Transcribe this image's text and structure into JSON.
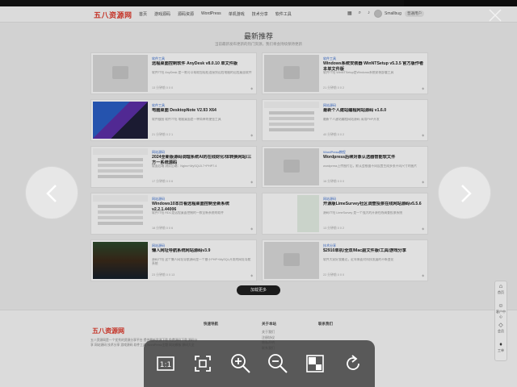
{
  "header": {
    "logo": "五八资源网",
    "nav": [
      "首页",
      "游戏源码",
      "源码资源",
      "WordPress",
      "单机游戏",
      "技术分享",
      "软件工具"
    ],
    "user_name": "Smallbug",
    "vip_badge": "普通用户"
  },
  "section": {
    "title": "最新推荐",
    "subtitle": "当前最新发布更新的热门资源，我们将会持续保持更新"
  },
  "posts": [
    {
      "category": "软件工具",
      "title": "远程桌面控制软件 AnyDesk v8.0.10 单文件版",
      "desc": "软件介绍 AnyDesk 是一款可以帮助您轻松连接到远程电脑的远程桌面软件",
      "meta": "13 分钟前   0   0   0",
      "thumb": "placeholder"
    },
    {
      "category": "软件工具",
      "title": "Windows系统安装器 WinNTSetup v5.3.5 官方版作者本单文件版",
      "desc": "软件介绍 WinNTSetup是Windows系统安装部署工具",
      "meta": "21 分钟前   0   0   2",
      "thumb": "placeholder"
    },
    {
      "category": "软件工具",
      "title": "电脑桌面 DesktopNote V2.93 X64",
      "desc": "软件截图 软件介绍 电脑桌面是一种简单的便签工具",
      "meta": "21 分钟前   0   2   1",
      "thumb": "blue"
    },
    {
      "category": "网站源码",
      "title": "最新个人建站编程网站源码 v1.6.0",
      "desc": "最新个人建站编程网站源码 采用PHP开发",
      "meta": "40 分钟前   0   0   2",
      "thumb": "shot"
    },
    {
      "category": "网站源码",
      "title": "2024全新版源码调理系统AI的在线财化/体转换网站/三方一系统源码",
      "desc": "版面后端 测试后端：Nginx+MySQL5.7+PHP7.4",
      "meta": "17 分钟前   0   0   6",
      "thumb": "shot"
    },
    {
      "category": "WordPress教程",
      "title": "Wordpress后续对象认选器智能软文件",
      "desc": "wordpress上传图片后，默认会根据不同设置生成多张不同尺寸的图片",
      "meta": "16 分钟前   0   0   0",
      "thumb": "placeholder"
    },
    {
      "category": "网站源码",
      "title": "Windows10本日看远程桌面控制全新系统 v2.2.1.44006",
      "desc": "软件介绍 RDC是远程桌面控制的一款全新系统的软件",
      "meta": "18 分钟前   0   0   6",
      "thumb": "shot"
    },
    {
      "category": "网站源码",
      "title": "开源版LimeSurvey社区调查投票在线网站源码v5.5.6",
      "desc": "源码介绍 LimeSurvey 是一个强大的开源在线调查投票系统",
      "meta": "13 分钟前   0   0   2",
      "thumb": "green"
    },
    {
      "category": "网站源码",
      "title": "懒人网址导航系统网站源码v3.9",
      "desc": "源码介绍 这个懒人网址导航源码是一个基于PHP+MySQL开发的网址导航系统",
      "meta": "23 分钟前   0   0   13",
      "thumb": "dark"
    },
    {
      "category": "技术分享",
      "title": "$2910单机/全双/Mac副文件版/工具/游戏分享",
      "desc": "软件大家好我最近，近年来面对科技发展的不断变化",
      "meta": "22 分钟前   0   0   0",
      "thumb": "placeholder"
    }
  ],
  "load_more": "加载更多",
  "footer": {
    "logo": "五八资源网",
    "desc": "五八资源网是一个优秀的资源分享平台 提供最新资源下载 免费源码下载 源码分享 网站源码 技术分享 游戏源码 软件工具 WordPress主题 网站模板 源码大全",
    "cols": [
      {
        "title": "快速导航",
        "links": []
      },
      {
        "title": "关于本站",
        "links": [
          "关于我们",
          "注册协议",
          "隐私声明",
          "联系我们"
        ]
      },
      {
        "title": "联系我们",
        "links": []
      }
    ]
  },
  "sidebar": [
    "首页",
    "客户中心",
    "会员",
    "工单"
  ],
  "viewer_tools": [
    "1:1",
    "fit-screen",
    "zoom-in",
    "zoom-out",
    "fullscreen",
    "rotate"
  ]
}
